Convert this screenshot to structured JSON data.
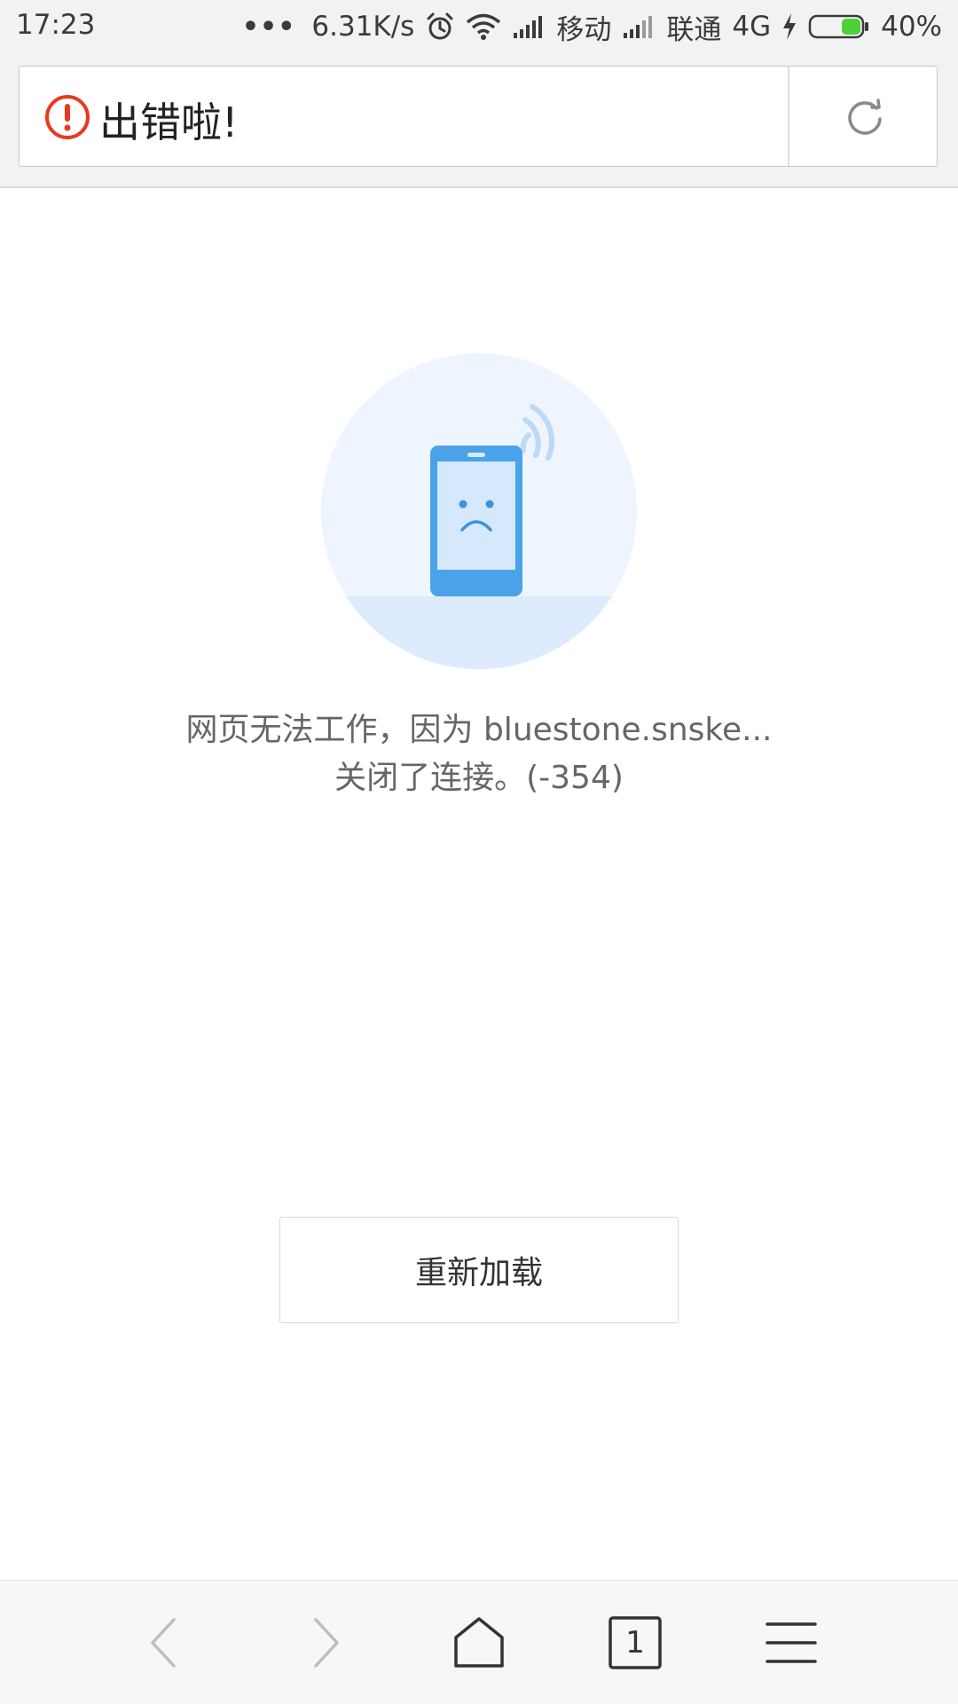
{
  "status_bar": {
    "time": "17:23",
    "more_indicator": "•••",
    "net_speed": "6.31K/s",
    "carrier1": "移动",
    "carrier2": "联通",
    "network_type": "4G",
    "battery_percent": "40%",
    "battery_level": 0.4,
    "icons": [
      "alarm-icon",
      "wifi-icon",
      "signal-icon",
      "charging-icon",
      "battery-icon"
    ]
  },
  "address_bar": {
    "title": "出错啦!",
    "error_icon": "error-circle-icon",
    "refresh_icon": "refresh-icon"
  },
  "error_page": {
    "illustration": "sad-phone-illustration",
    "message_line1": "网页无法工作，因为 bluestone.snske...",
    "message_line2": "关闭了连接。(-354)",
    "reload_button_label": "重新加载"
  },
  "bottom_nav": {
    "tab_count": "1",
    "icons": [
      "back-icon",
      "forward-icon",
      "home-icon",
      "tabs-icon",
      "menu-icon"
    ]
  },
  "colors": {
    "error_red": "#e8391f",
    "phone_blue": "#4aa2e8",
    "circle_bg": "#eef5fe",
    "battery_green": "#4cd137"
  }
}
